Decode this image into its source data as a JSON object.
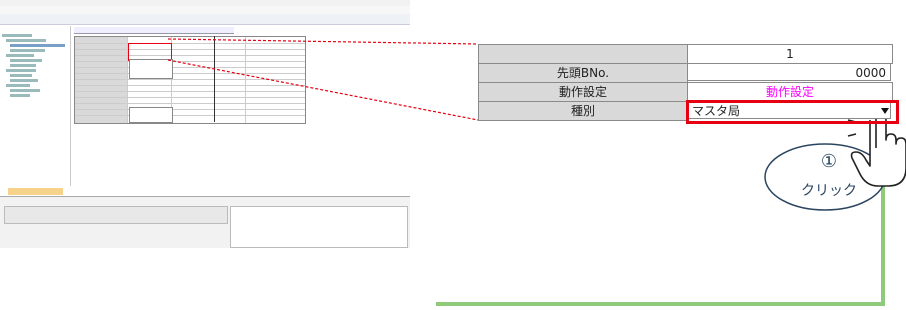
{
  "zoom_table": {
    "header": "1",
    "rows": [
      {
        "label": "先頭BNo.",
        "value": "0000"
      },
      {
        "label": "動作設定",
        "value": "動作設定"
      },
      {
        "label": "種別",
        "value": "マスタ局"
      }
    ]
  },
  "callout": {
    "step": "①",
    "action": "クリック"
  },
  "colors": {
    "highlight_border": "#e60012",
    "callout_line": "#e60012",
    "connector": "#8fc97a",
    "bubble_border": "#2b4560",
    "label_bg": "#d9d9d9",
    "link_text": "#ff00ff"
  },
  "icons": [
    "hand-pointer-icon",
    "dropdown-arrow-icon"
  ]
}
